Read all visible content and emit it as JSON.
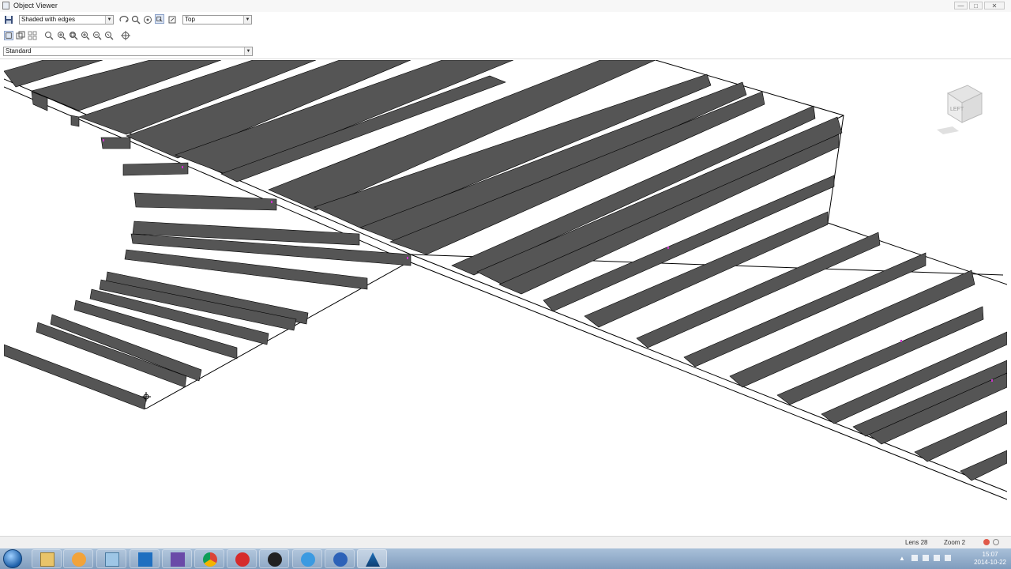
{
  "window": {
    "title": "Object Viewer",
    "buttons": [
      "—",
      "□",
      "✕"
    ]
  },
  "toolbar": {
    "shade_mode": "Shaded with edges",
    "view": "Top",
    "style": "Standard"
  },
  "viewcube": {
    "face_label": "LEFT"
  },
  "status": {
    "lens": "Lens 28",
    "zoom": "Zoom 2"
  },
  "taskbar": {
    "apps": [
      "explorer",
      "media-player",
      "notepad",
      "outlook",
      "visual-studio",
      "chrome",
      "opera",
      "obs",
      "internet-explorer",
      "settings",
      "autocad"
    ],
    "clock_time": "15:07",
    "clock_date": "2014-10-22"
  },
  "colors": {
    "beam": "#555555",
    "edge": "#000000",
    "accent": "#cc33cc"
  }
}
